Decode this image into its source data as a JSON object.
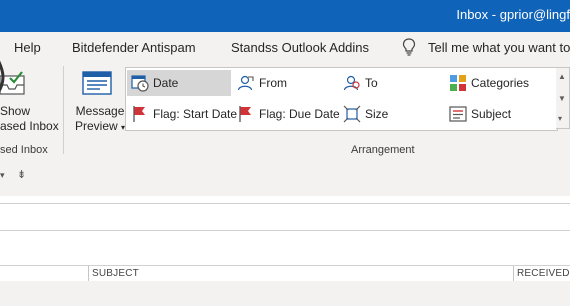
{
  "window": {
    "title": "Inbox - gprior@lingf"
  },
  "menu": {
    "help": "Help",
    "bitdefender": "Bitdefender Antispam",
    "standss": "Standss Outlook Addins",
    "tell_me": "Tell me what you want to",
    "tell_me_icon": "lightbulb-icon"
  },
  "ribbon": {
    "show_focused": {
      "line1": "Show",
      "line2": "ased Inbox",
      "group": "sed Inbox"
    },
    "message_preview": {
      "line1": "Message",
      "line2": "Preview"
    },
    "arrangement": {
      "group_label": "Arrangement",
      "items": [
        {
          "label": "Date",
          "icon": "calendar-clock-icon",
          "selected": true
        },
        {
          "label": "From",
          "icon": "contact-card-icon"
        },
        {
          "label": "To",
          "icon": "contact-to-icon"
        },
        {
          "label": "Categories",
          "icon": "categories-icon"
        },
        {
          "label": "Flag: Start Date",
          "icon": "red-flag-icon"
        },
        {
          "label": "Flag: Due Date",
          "icon": "red-flag-due-icon"
        },
        {
          "label": "Size",
          "icon": "size-icon"
        },
        {
          "label": "Subject",
          "icon": "subject-icon"
        }
      ]
    }
  },
  "message_list": {
    "columns": {
      "subject": "SUBJECT",
      "received": "RECEIVED"
    }
  },
  "colors": {
    "titlebar": "#0f63b9",
    "ribbon_bg": "#f3f2f1",
    "selected": "#d6d6d6"
  }
}
